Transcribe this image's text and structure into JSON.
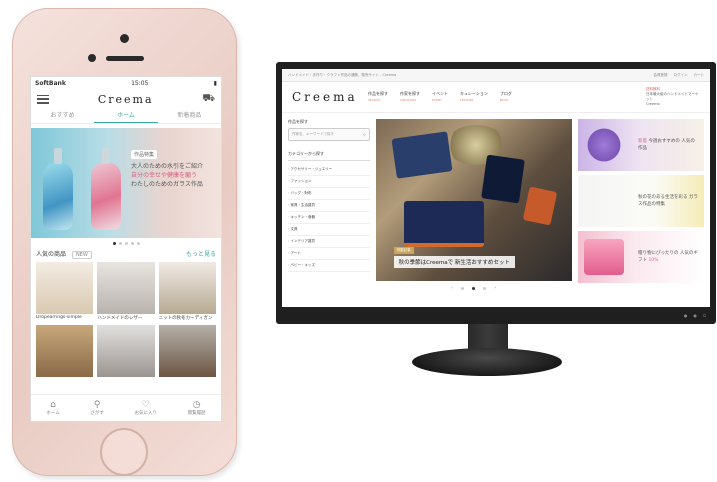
{
  "phone": {
    "status": {
      "carrier": "SoftBank",
      "time": "15:05"
    },
    "logo": "Creema",
    "tabs": [
      {
        "label": "おすすめ"
      },
      {
        "label": "ホーム"
      },
      {
        "label": "新着商品"
      }
    ],
    "hero": {
      "badge": "作品特集",
      "line1": "大人のための水引をご紹介",
      "line2": "自分の幸せや健康を願う",
      "line3": "わたしのためのガラス作品"
    },
    "section": {
      "title": "人気の商品",
      "chip": "NEW",
      "more": "もっと見る"
    },
    "items": [
      {
        "label": "Dropearrings-simple"
      },
      {
        "label": "ハンドメイドのレザー"
      },
      {
        "label": "ニットの秋冬カーディガン"
      },
      {
        "label": ""
      },
      {
        "label": ""
      },
      {
        "label": ""
      }
    ],
    "bottom_nav": [
      {
        "label": "ホーム",
        "icon": "home-icon"
      },
      {
        "label": "さがす",
        "icon": "search-icon"
      },
      {
        "label": "お気に入り",
        "icon": "heart-icon"
      },
      {
        "label": "閲覧履歴",
        "icon": "history-icon"
      }
    ]
  },
  "web": {
    "topbar": {
      "left": "ハンドメイド・手作り・クラフト作品の通販、販売サイト - Creema",
      "right": [
        "会員登録",
        "ログイン",
        "カート"
      ]
    },
    "logo": "Creema",
    "nav": [
      {
        "label": "作品を探す",
        "sub": "SEARCH"
      },
      {
        "label": "作家を探す",
        "sub": "CREATORS"
      },
      {
        "label": "イベント",
        "sub": "EVENT"
      },
      {
        "label": "キュレーション",
        "sub": "FEATURE"
      },
      {
        "label": "ブログ",
        "sub": "BLOG"
      }
    ],
    "ad": {
      "line1": "送料無料",
      "line2": "日本最大級のハンドメイドマーケット",
      "line3": "Creema"
    },
    "sidebar": {
      "keyword_label": "作品を探す",
      "search_placeholder": "作家名、キーワードで探す",
      "category_title": "カテゴリーから探す",
      "categories": [
        "アクセサリー・ジュエリー",
        "ファッション",
        "バッグ・財布",
        "家具・生活雑貨",
        "キッチン・食器",
        "文具",
        "インテリア雑貨",
        "アート",
        "ベビー・キッズ"
      ]
    },
    "hero": {
      "tag": "特集記事",
      "caption": "秋の季節はCreemaで 新生活おすすめセット"
    },
    "banners": [
      {
        "text": "今週おすすめの 人気の作品",
        "accent": "新着"
      },
      {
        "text": "秋の花のある生活を彩る ガラス作品の特集",
        "accent": ""
      },
      {
        "text": "贈り物にぴったりの 人気のギフト",
        "accent": "10%"
      }
    ]
  },
  "colors": {
    "accent": "#39a9a0",
    "pink": "#e06a8a",
    "phone_shell": "#e8cbc3",
    "monitor": "#1f1f1f"
  }
}
